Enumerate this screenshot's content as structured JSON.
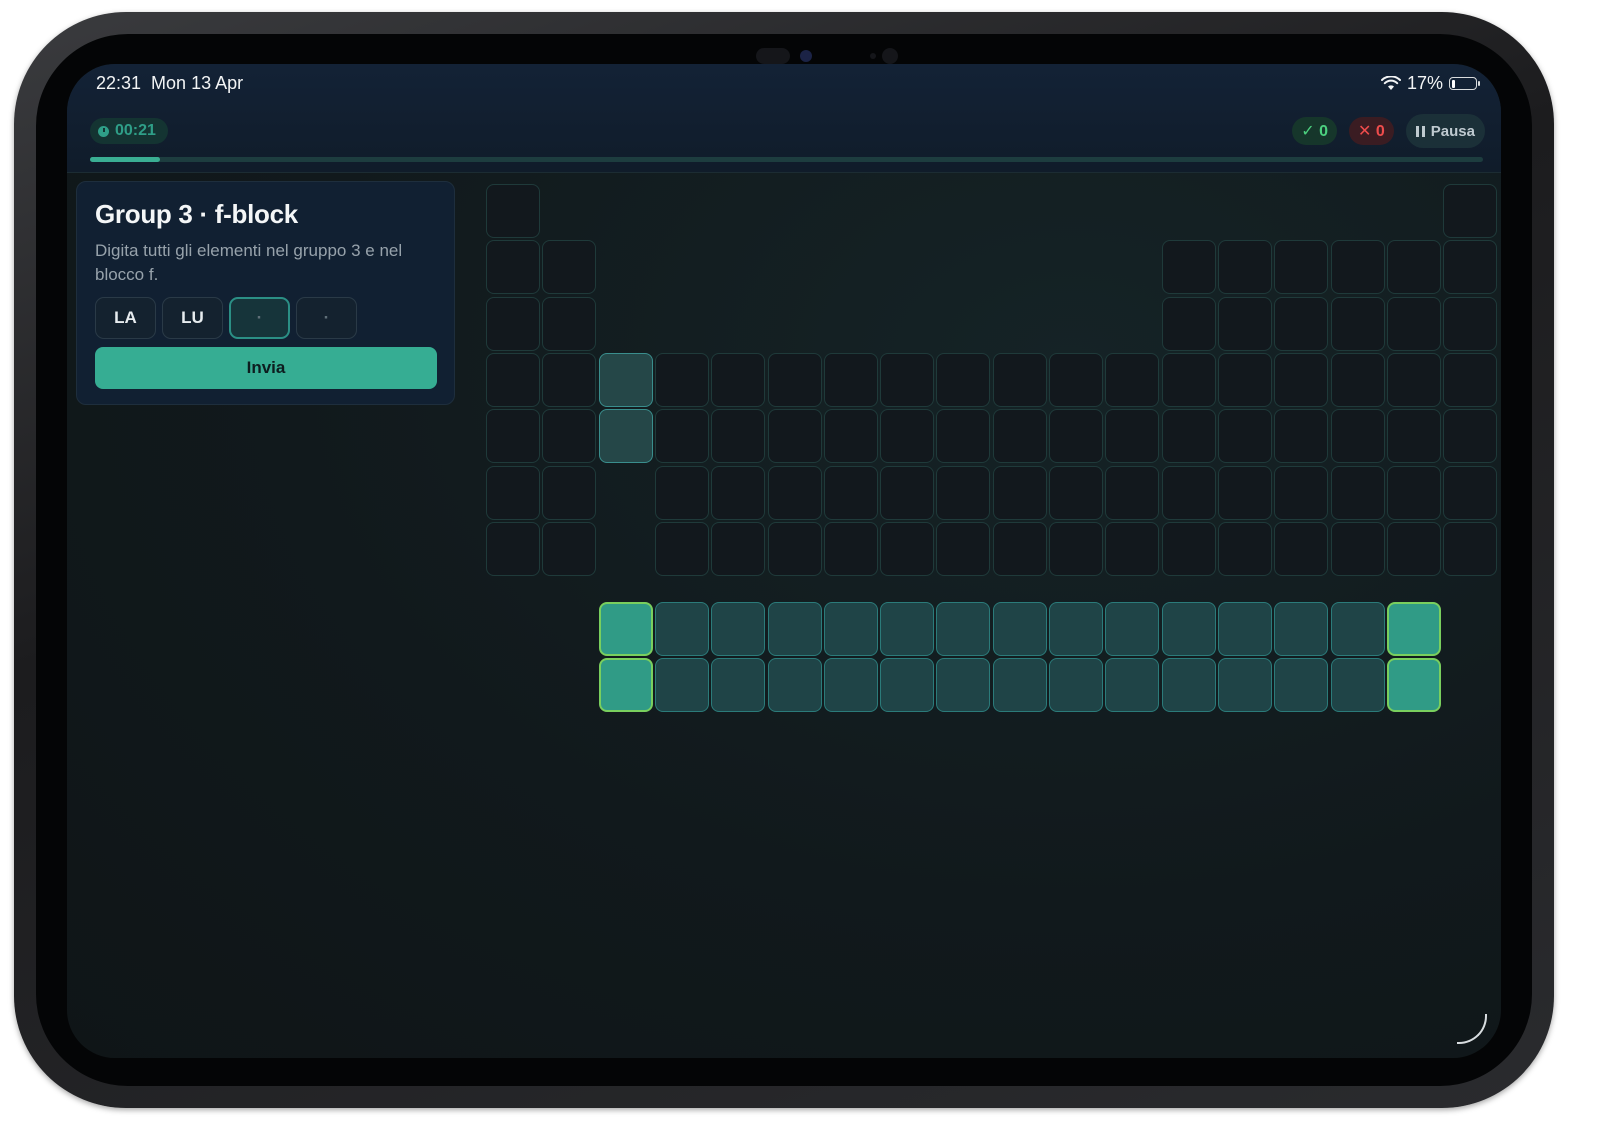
{
  "status_bar": {
    "time": "22:31",
    "date": "Mon 13 Apr",
    "battery": "17%",
    "battery_level": 0.17,
    "wifi_icon": "wifi-icon",
    "battery_icon": "battery-icon"
  },
  "quiz_bar": {
    "timer": "00:21",
    "correct_count": "✓ 0",
    "wrong_count": "✕ 0",
    "pause_label": "Pausa",
    "progress": 0.05
  },
  "prompt": {
    "title": "Group 3 · f-block",
    "description": "Digita tutti gli elementi nel gruppo 3 e nel blocco f.",
    "chips": [
      "LA",
      "LU",
      "·",
      "·"
    ],
    "submit_label": "Invia"
  },
  "colors": {
    "accent": "#36ad93",
    "correct": "#4cd17f",
    "wrong": "#ee4c4c",
    "background": "#11191c"
  }
}
